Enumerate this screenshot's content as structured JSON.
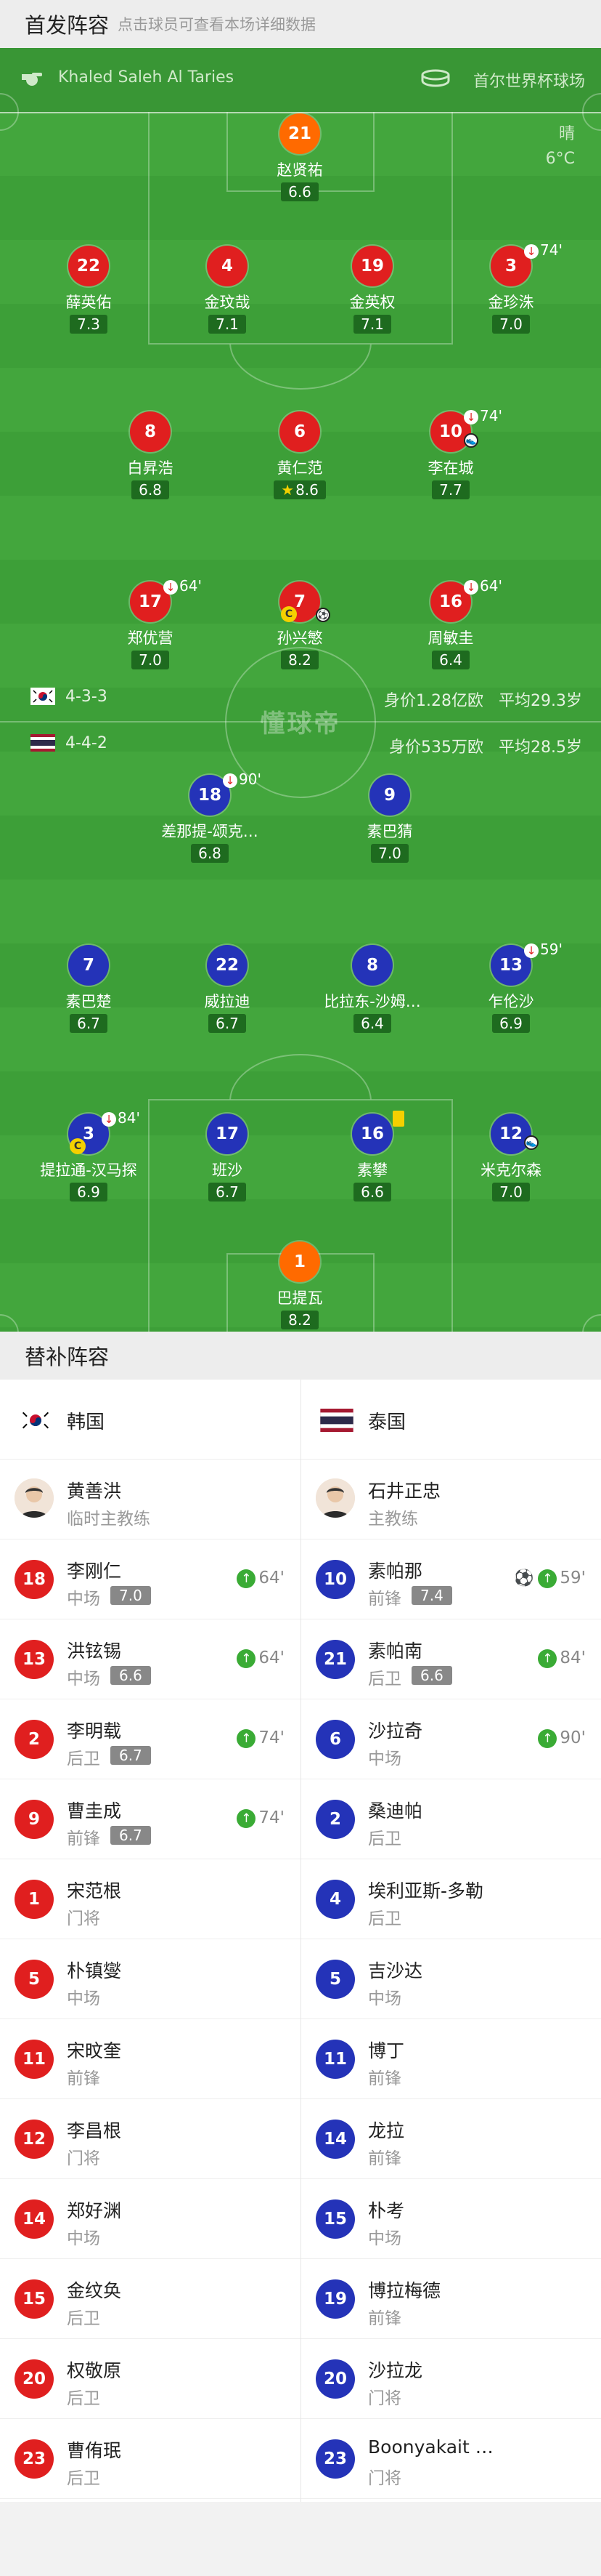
{
  "header": {
    "title": "首发阵容",
    "subtitle": "点击球员可查看本场详细数据"
  },
  "match": {
    "referee": "Khaled Saleh Al Taries",
    "venue": "首尔世界杯球场",
    "weather": "晴",
    "temperature": "6°C"
  },
  "watermark": "懂球帝",
  "home_team": {
    "formation": "4-3-3",
    "value": "身价1.28亿欧",
    "avg_age": "平均29.3岁"
  },
  "away_team": {
    "formation": "4-4-2",
    "value": "身价535万欧",
    "avg_age": "平均28.5岁"
  },
  "home_players": [
    {
      "number": "21",
      "name": "赵贤祐",
      "rating": "6.6"
    },
    {
      "number": "22",
      "name": "薛英佑",
      "rating": "7.3"
    },
    {
      "number": "4",
      "name": "金玟哉",
      "rating": "7.1"
    },
    {
      "number": "19",
      "name": "金英权",
      "rating": "7.1"
    },
    {
      "number": "3",
      "name": "金珍洙",
      "rating": "7.0",
      "sub_time": "74'"
    },
    {
      "number": "8",
      "name": "白昇浩",
      "rating": "6.8"
    },
    {
      "number": "6",
      "name": "黄仁范",
      "rating": "8.6"
    },
    {
      "number": "10",
      "name": "李在城",
      "rating": "7.7",
      "sub_time": "74'"
    },
    {
      "number": "17",
      "name": "郑优营",
      "rating": "7.0",
      "sub_time": "64'"
    },
    {
      "number": "7",
      "name": "孙兴慜",
      "rating": "8.2"
    },
    {
      "number": "16",
      "name": "周敏圭",
      "rating": "6.4",
      "sub_time": "64'"
    }
  ],
  "away_players": [
    {
      "number": "18",
      "name": "差那提-颂克…",
      "rating": "6.8",
      "sub_time": "90'"
    },
    {
      "number": "9",
      "name": "素巴猜",
      "rating": "7.0"
    },
    {
      "number": "7",
      "name": "素巴楚",
      "rating": "6.7"
    },
    {
      "number": "22",
      "name": "威拉迪",
      "rating": "6.7"
    },
    {
      "number": "8",
      "name": "比拉东-沙姆…",
      "rating": "6.4"
    },
    {
      "number": "13",
      "name": "乍伦沙",
      "rating": "6.9",
      "sub_time": "59'"
    },
    {
      "number": "3",
      "name": "提拉通-汉马探",
      "rating": "6.9",
      "sub_time": "84'"
    },
    {
      "number": "17",
      "name": "班沙",
      "rating": "6.7"
    },
    {
      "number": "16",
      "name": "素攀",
      "rating": "6.6"
    },
    {
      "number": "12",
      "name": "米克尔森",
      "rating": "7.0"
    },
    {
      "number": "1",
      "name": "巴提瓦",
      "rating": "8.2"
    }
  ],
  "bench": {
    "title": "替补阵容",
    "home": {
      "team": "韩国",
      "coach": {
        "name": "黄善洪",
        "role": "临时主教练"
      },
      "players": [
        {
          "number": "18",
          "name": "李刚仁",
          "pos": "中场",
          "rating": "7.0",
          "on": "64'"
        },
        {
          "number": "13",
          "name": "洪铉锡",
          "pos": "中场",
          "rating": "6.6",
          "on": "64'"
        },
        {
          "number": "2",
          "name": "李明载",
          "pos": "后卫",
          "rating": "6.7",
          "on": "74'"
        },
        {
          "number": "9",
          "name": "曹圭成",
          "pos": "前锋",
          "rating": "6.7",
          "on": "74'"
        },
        {
          "number": "1",
          "name": "宋范根",
          "pos": "门将"
        },
        {
          "number": "5",
          "name": "朴镇燮",
          "pos": "中场"
        },
        {
          "number": "11",
          "name": "宋旼奎",
          "pos": "前锋"
        },
        {
          "number": "12",
          "name": "李昌根",
          "pos": "门将"
        },
        {
          "number": "14",
          "name": "郑好渊",
          "pos": "中场"
        },
        {
          "number": "15",
          "name": "金纹奂",
          "pos": "后卫"
        },
        {
          "number": "20",
          "name": "权敬原",
          "pos": "后卫"
        },
        {
          "number": "23",
          "name": "曹侑珉",
          "pos": "后卫"
        }
      ]
    },
    "away": {
      "team": "泰国",
      "coach": {
        "name": "石井正忠",
        "role": "主教练"
      },
      "players": [
        {
          "number": "10",
          "name": "素帕那",
          "pos": "前锋",
          "rating": "7.4",
          "on": "59'"
        },
        {
          "number": "21",
          "name": "素帕南",
          "pos": "后卫",
          "rating": "6.6",
          "on": "84'"
        },
        {
          "number": "6",
          "name": "沙拉奇",
          "pos": "中场",
          "on": "90'"
        },
        {
          "number": "2",
          "name": "桑迪帕",
          "pos": "后卫"
        },
        {
          "number": "4",
          "name": "埃利亚斯-多勒",
          "pos": "后卫"
        },
        {
          "number": "5",
          "name": "吉沙达",
          "pos": "中场"
        },
        {
          "number": "11",
          "name": "博丁",
          "pos": "前锋"
        },
        {
          "number": "14",
          "name": "龙拉",
          "pos": "前锋"
        },
        {
          "number": "15",
          "name": "朴考",
          "pos": "中场"
        },
        {
          "number": "19",
          "name": "博拉梅德",
          "pos": "前锋"
        },
        {
          "number": "20",
          "name": "沙拉龙",
          "pos": "门将"
        },
        {
          "number": "23",
          "name": "Boonyakait …",
          "pos": "门将"
        }
      ]
    }
  },
  "colors": {
    "home": "#e01f1f",
    "away": "#2433b8",
    "keeper_home": "#ff6a00",
    "pitch": "#3d9f38",
    "sub_on": "#3aab35"
  }
}
